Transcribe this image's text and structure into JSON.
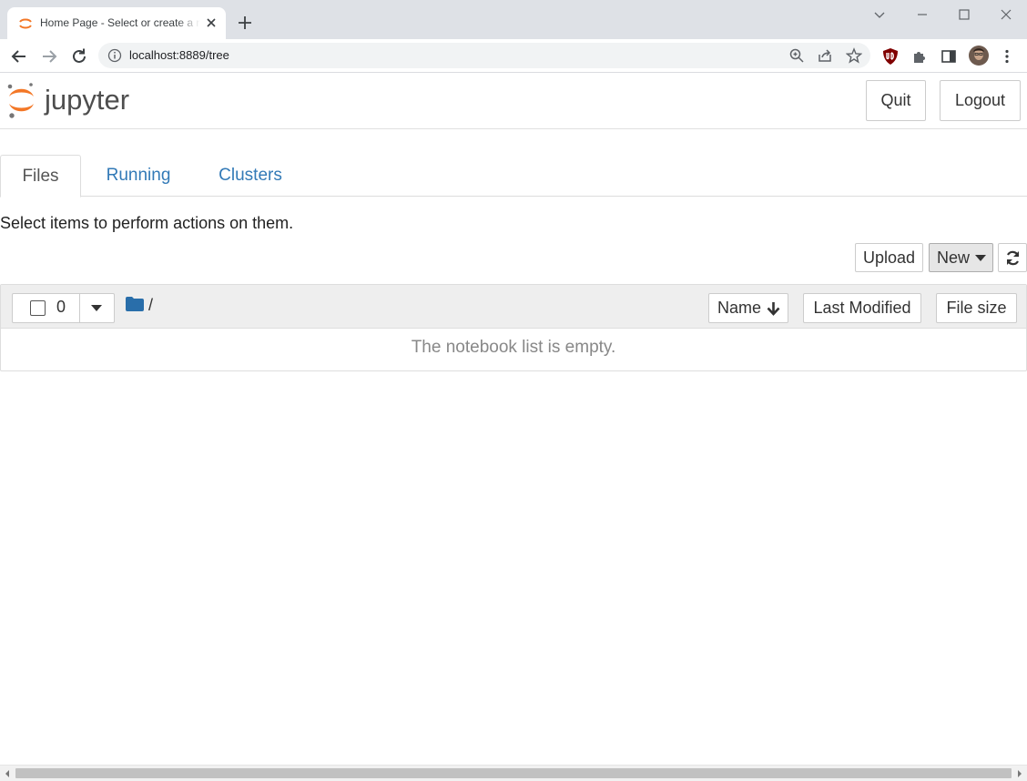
{
  "browser": {
    "tab_title": "Home Page - Select or create a notebook",
    "url": "localhost:8889/tree"
  },
  "header": {
    "logo_text": "jupyter",
    "quit_label": "Quit",
    "logout_label": "Logout"
  },
  "tabs": [
    {
      "label": "Files",
      "active": true
    },
    {
      "label": "Running",
      "active": false
    },
    {
      "label": "Clusters",
      "active": false
    }
  ],
  "hint": "Select items to perform actions on them.",
  "actions": {
    "upload_label": "Upload",
    "new_label": "New"
  },
  "file_list": {
    "selected_count": "0",
    "breadcrumb": "/",
    "columns": [
      "Name",
      "Last Modified",
      "File size"
    ],
    "empty_message": "The notebook list is empty."
  },
  "colors": {
    "jupyter_orange": "#f37726",
    "link_blue": "#337ab7",
    "folder_blue": "#296eaa"
  }
}
